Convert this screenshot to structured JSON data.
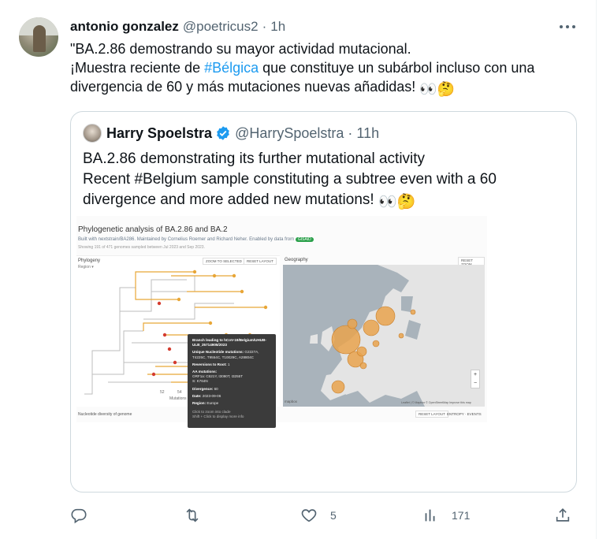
{
  "tweet": {
    "author_name": "antonio gonzalez",
    "author_handle": "@poetricus2",
    "separator": "·",
    "time": "1h",
    "text_line1": "\"BA.2.86 demostrando su mayor actividad mutacional.",
    "text_line2_pre": "¡Muestra reciente de ",
    "text_line2_hashtag": "#Bélgica",
    "text_line2_post": " que constituye un subárbol incluso con una",
    "text_line3": "divergencia de 60 y más mutaciones nuevas añadidas! ",
    "emoji": "👀🤔"
  },
  "quote": {
    "author_name": "Harry Spoelstra",
    "author_handle": "@HarrySpoelstra",
    "separator": "·",
    "time": "11h",
    "text_line1": "BA.2.86 demonstrating its further mutational activity",
    "text_line2": "Recent #Belgium sample constituting a subtree even with a 60",
    "text_line3": "divergence and more added new mutations! ",
    "emoji": "👀🤔"
  },
  "media": {
    "title": "Phylogenetic analysis of BA.2.86 and BA.2",
    "built_with": "Built with nextstrain/BA286. Maintained by Cornelius Roemer and Richard Neher. Enabled by data from",
    "gisaid": "GISAID",
    "showing": "Showing 191 of 471 genomes sampled between Jul 2023 and Sep 2023.",
    "phylogeny_label": "Phylogeny",
    "region_label": "Region ▾",
    "zoom_selected": "ZOOM TO SELECTED",
    "reset_layout": "RESET LAYOUT",
    "geography_label": "Geography",
    "reset_zoom": "RESET ZOOM",
    "axis_ticks": [
      "52",
      "54",
      "56",
      "58",
      "60"
    ],
    "axis_label": "Mutations",
    "diversity_label": "Nucleotide diversity of genome",
    "reset_layout2": "RESET LAYOUT",
    "entropy_events": "ENTROPY · EVENTS",
    "map_credit": "Leaflet | © Mapbox © OpenStreetMap Improve this map",
    "map_logo": "mapbox",
    "tooltip": {
      "branch": "Branch leading to hCoV-19/Belgium/UHUB-ULB_25714905/2023",
      "nuc_title": "Unique Nucleotide mutations:",
      "nuc_val": "G2227A, T4225C, T9554C, T10029C, A28804C",
      "rev_title": "Reversions to Root:",
      "rev_val": "1",
      "aa_title": "AA mutations:",
      "aa_val1": "ORF1a: C621Y, I3090T, I3255T",
      "aa_val2": "S: K764N",
      "div_title": "Divergence:",
      "div_val": "60",
      "date_title": "Date:",
      "date_val": "2023-09-06",
      "region_title": "Region:",
      "region_val": "Europe",
      "hint1": "Click to zoom into clade",
      "hint2": "Shift + Click to display more info"
    }
  },
  "actions": {
    "reply_count": "",
    "retweet_count": "",
    "like_count": "5",
    "views_count": "171"
  },
  "colors": {
    "link": "#1d9bf0",
    "muted": "#536471",
    "verified": "#1d9bf0",
    "bubble": "#e9a34e"
  }
}
